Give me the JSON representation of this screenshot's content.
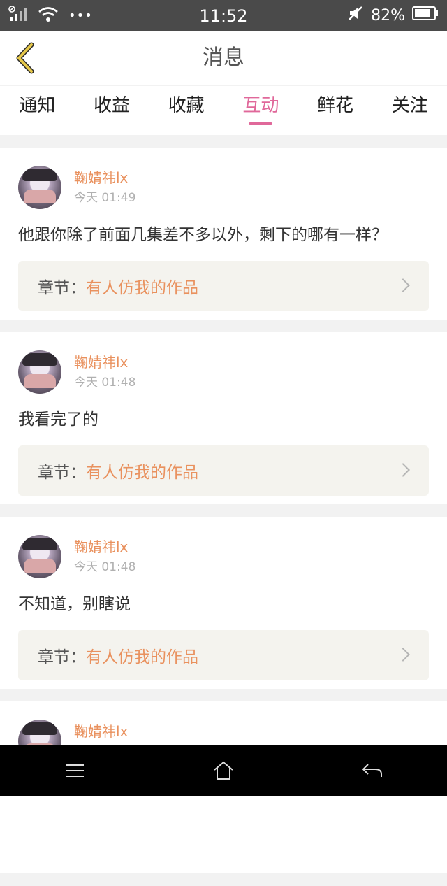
{
  "status_bar": {
    "time": "11:52",
    "battery": "82%",
    "more": "•••"
  },
  "nav": {
    "title": "消息"
  },
  "tabs": [
    {
      "label": "通知",
      "active": false
    },
    {
      "label": "收益",
      "active": false
    },
    {
      "label": "收藏",
      "active": false
    },
    {
      "label": "互动",
      "active": true
    },
    {
      "label": "鲜花",
      "active": false
    },
    {
      "label": "关注",
      "active": false
    }
  ],
  "chapter_label": "章节：",
  "items": [
    {
      "username": "鞠婧祎lx",
      "time": "今天 01:49",
      "comment": "他跟你除了前面几集差不多以外，剩下的哪有一样？",
      "chapter": "有人仿我的作品"
    },
    {
      "username": "鞠婧祎lx",
      "time": "今天 01:48",
      "comment": "我看完了的",
      "chapter": "有人仿我的作品"
    },
    {
      "username": "鞠婧祎lx",
      "time": "今天 01:48",
      "comment": "不知道，别瞎说",
      "chapter": "有人仿我的作品"
    },
    {
      "username": "鞠婧祎lx"
    }
  ],
  "colors": {
    "accent": "#e0689a",
    "username": "#e9915e",
    "back_arrow": "#e6c84a"
  }
}
